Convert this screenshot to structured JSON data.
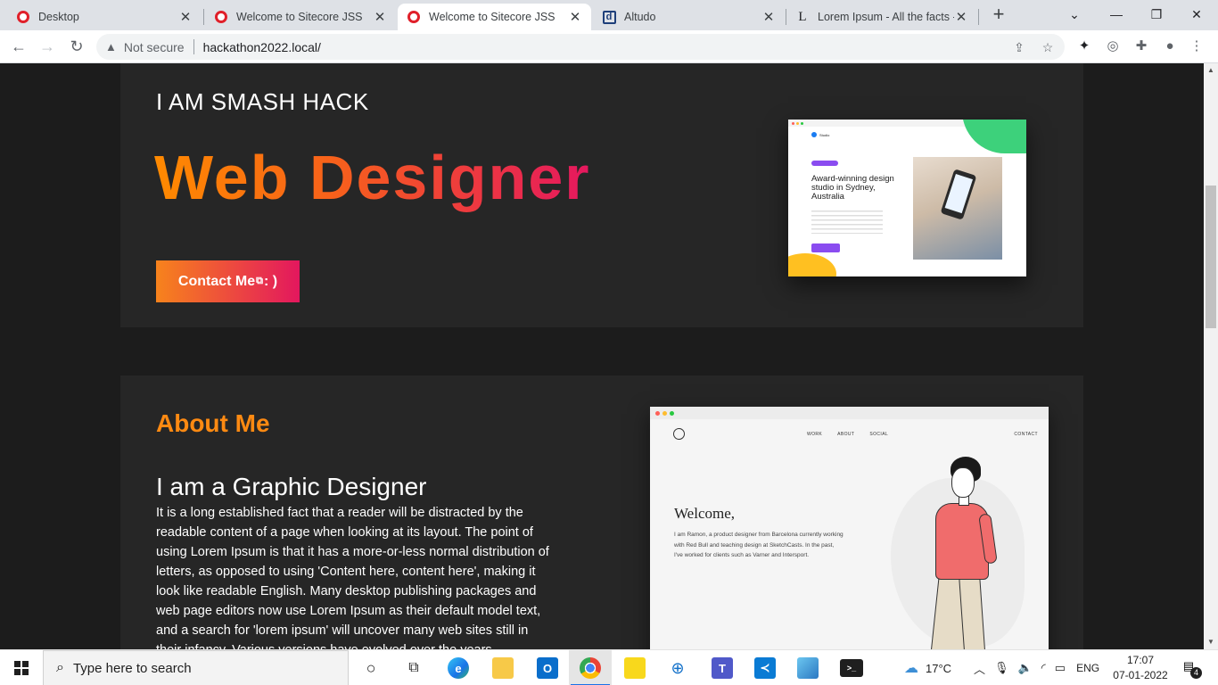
{
  "browser": {
    "tabs": [
      {
        "title": "Desktop",
        "icon": "opera-icon"
      },
      {
        "title": "Welcome to Sitecore JSS",
        "icon": "opera-icon"
      },
      {
        "title": "Welcome to Sitecore JSS",
        "icon": "opera-icon"
      },
      {
        "title": "Altudo",
        "icon": "d-letter-icon"
      },
      {
        "title": "Lorem Ipsum - All the facts -",
        "icon": "l-letter-icon"
      }
    ],
    "security_label": "Not secure",
    "url": "hackathon2022.local/"
  },
  "hero": {
    "eyebrow": "I AM SMASH HACK",
    "title": "Web Designer",
    "contact_button": "Contact Me",
    "contact_suffix": " : )",
    "mock": {
      "brand": "Studio",
      "heading": "Award-winning design studio in Sydney, Australia"
    }
  },
  "about": {
    "heading": "About Me",
    "subheading": "I am a Graphic Designer",
    "body": "It is a long established fact that a reader will be distracted by the readable content of a page when looking at its layout. The point of using Lorem Ipsum is that it has a more-or-less normal distribution of letters, as opposed to using 'Content here, content here', making it look like readable English. Many desktop publishing packages and web page editors now use Lorem Ipsum as their default model text, and a search for 'lorem ipsum' will uncover many web sites still in their infancy. Various versions have evolved over the years, sometimes by",
    "mock": {
      "nav": [
        "WORK",
        "ABOUT",
        "SOCIAL"
      ],
      "nav_right": "CONTACT",
      "welcome": "Welcome,",
      "intro": "I am Ramon, a product designer from Barcelona currently working with Red Bull and teaching design at SketchCasts. In the past, I've worked for clients such as Varner and Intersport."
    }
  },
  "taskbar": {
    "search_placeholder": "Type here to search",
    "temperature": "17°C",
    "language": "ENG",
    "time": "17:07",
    "date": "07-01-2022",
    "notifications": "4"
  },
  "colors": {
    "accent_orange": "#ff8a12",
    "accent_pink": "#e3175e",
    "page_bg": "#1c1c1c",
    "section_bg": "#262626"
  }
}
